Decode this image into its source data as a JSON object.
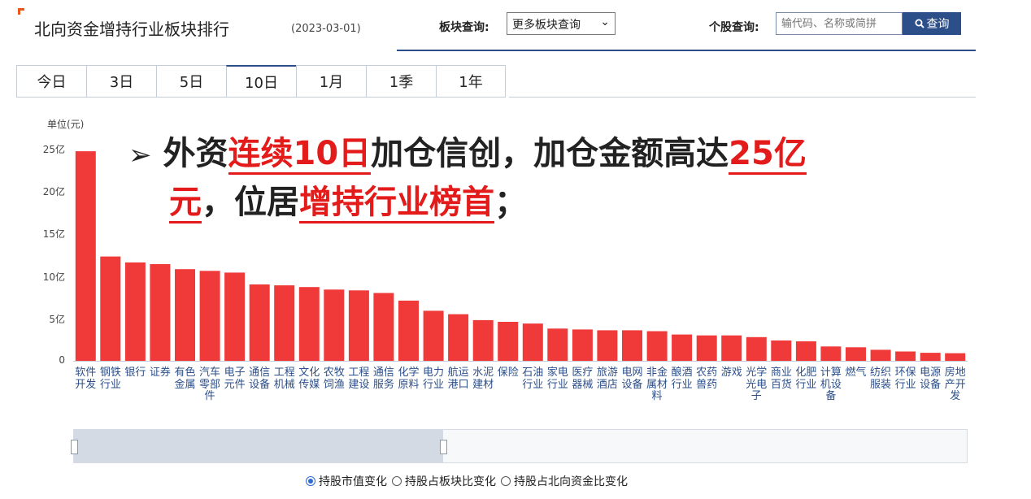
{
  "header": {
    "title": "北向资金增持行业板块排行",
    "date": "(2023-03-01)",
    "sector_query_label": "板块查询:",
    "sector_select_value": "更多板块查询",
    "stock_query_label": "个股查询:",
    "stock_input_placeholder": "输代码、名称或简拼",
    "query_button_label": "查询"
  },
  "tabs": [
    {
      "label": "今日",
      "active": false
    },
    {
      "label": "3日",
      "active": false
    },
    {
      "label": "5日",
      "active": false
    },
    {
      "label": "10日",
      "active": true
    },
    {
      "label": "1月",
      "active": false
    },
    {
      "label": "1季",
      "active": false
    },
    {
      "label": "1年",
      "active": false
    }
  ],
  "annotation": {
    "bullet": "➢",
    "p1": "外资",
    "h1": "连续10日",
    "p2": "加仓信创，加仓金额高达",
    "h2": "25亿",
    "h3": "元",
    "p3": "，位居",
    "h4": "增持行业榜首",
    "p4": "；"
  },
  "radio_options": [
    {
      "label": "持股市值变化",
      "selected": true
    },
    {
      "label": "持股占板块比变化",
      "selected": false
    },
    {
      "label": "持股占北向资金比变化",
      "selected": false
    }
  ],
  "colors": {
    "bar": "#f03a3a",
    "accent": "#2c4f8a",
    "highlight": "#e31b1b"
  },
  "chart_data": {
    "type": "bar",
    "ylabel": "单位(元)",
    "ylim": [
      0,
      25
    ],
    "yticks": [
      "0",
      "5亿",
      "10亿",
      "15亿",
      "20亿",
      "25亿"
    ],
    "ytick_values": [
      0,
      5,
      10,
      15,
      20,
      25
    ],
    "categories": [
      "软件开发",
      "钢铁行业",
      "银行",
      "证券",
      "有色金属",
      "汽车零部件",
      "电子元件",
      "通信设备",
      "工程机械",
      "文化传媒",
      "农牧饲渔",
      "工程建设",
      "通信服务",
      "化学原料",
      "电力行业",
      "航运港口",
      "水泥建材",
      "保险",
      "石油行业",
      "家电行业",
      "医疗器械",
      "旅游酒店",
      "电网设备",
      "非金属材料",
      "酿酒行业",
      "农药兽药",
      "游戏",
      "光学光电子",
      "商业百货",
      "化肥行业",
      "计算机设备",
      "燃气",
      "纺织服装",
      "环保行业",
      "电源设备",
      "房地产开发"
    ],
    "values": [
      24.7,
      12.3,
      11.6,
      11.4,
      10.8,
      10.6,
      10.4,
      9.0,
      8.9,
      8.7,
      8.4,
      8.3,
      8.0,
      7.1,
      5.9,
      5.5,
      4.8,
      4.6,
      4.4,
      3.8,
      3.7,
      3.6,
      3.6,
      3.5,
      3.1,
      3.0,
      3.0,
      2.8,
      2.4,
      2.3,
      1.7,
      1.6,
      1.3,
      1.1,
      0.95,
      0.9
    ]
  }
}
